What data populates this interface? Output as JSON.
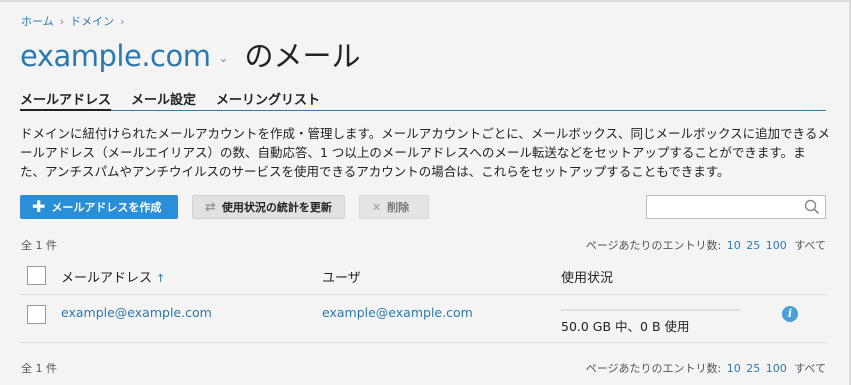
{
  "breadcrumb": {
    "home": "ホーム",
    "domains": "ドメイン",
    "sep": "›"
  },
  "header": {
    "domain": "example.com",
    "title": "のメール",
    "caret": "⌄"
  },
  "tabs": [
    {
      "label": "メールアドレス",
      "active": true
    },
    {
      "label": "メール設定",
      "active": false
    },
    {
      "label": "メーリングリスト",
      "active": false
    }
  ],
  "description": "ドメインに紐付けられたメールアカウントを作成・管理します。メールアカウントごとに、メールボックス、同じメールボックスに追加できるメールアドレス（メールエイリアス）の数、自動応答、1 つ以上のメールアドレスへのメール転送などをセットアップすることができます。また、アンチスパムやアンチウイルスのサービスを使用できるアカウントの場合は、これらをセットアップすることもできます。",
  "toolbar": {
    "create_label": "メールアドレスを作成",
    "refresh_label": "使用状況の統計を更新",
    "delete_label": "削除"
  },
  "search": {
    "placeholder": "",
    "value": ""
  },
  "list": {
    "total": "全 1 件",
    "per_page_label": "ページあたりのエントリ数:",
    "per_page_options": [
      "10",
      "25",
      "100"
    ],
    "per_page_all": "すべて"
  },
  "table": {
    "columns": {
      "email": "メールアドレス",
      "sort": "↑",
      "user": "ユーザ",
      "usage": "使用状況"
    },
    "rows": [
      {
        "email": "example@example.com",
        "user": "example@example.com",
        "usage": "50.0 GB 中、0 B 使用"
      }
    ]
  },
  "colors": {
    "accent": "#2a7ab0",
    "primary_button": "#2a8fd6"
  }
}
